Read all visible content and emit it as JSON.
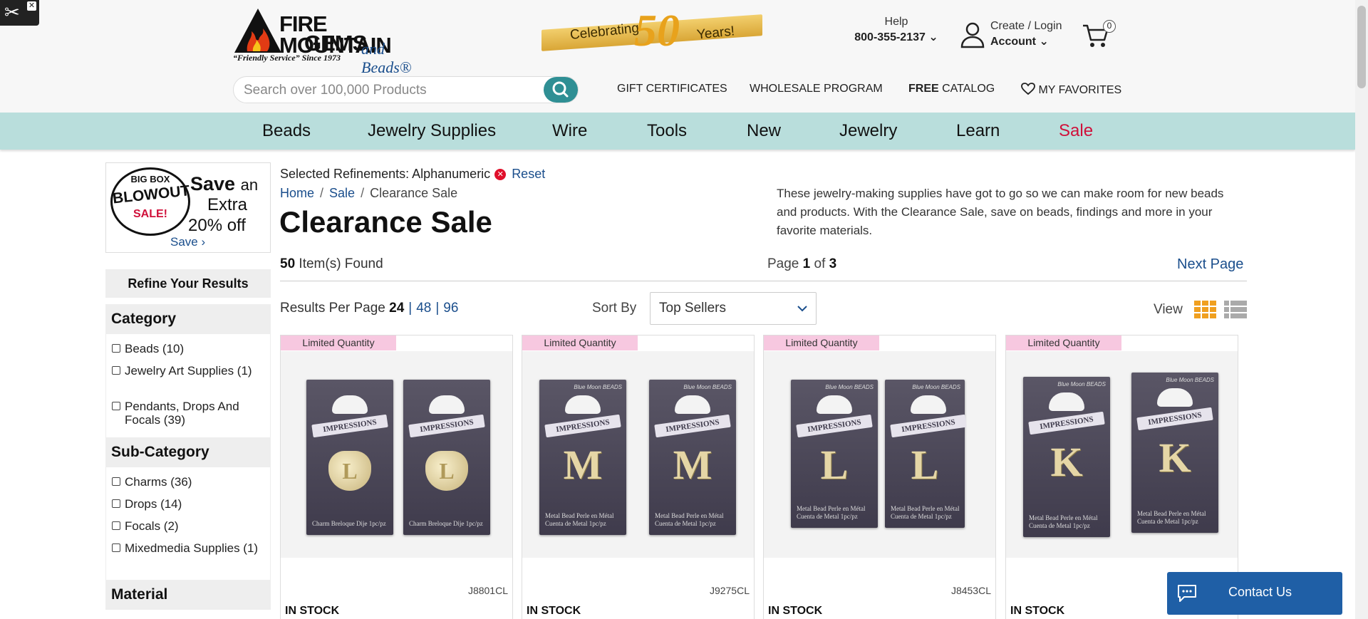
{
  "header": {
    "brand_line1": "FIRE MOUNTAIN",
    "brand_line2": "GEMS",
    "brand_line3": "and Beads®",
    "tagline": "“Friendly Service” Since 1973",
    "celebrating": "Celebrating",
    "fifty": "50",
    "years": "Years!",
    "help_label": "Help",
    "phone": "800-355-2137",
    "create_login": "Create / Login",
    "account": "Account",
    "cart_count": "0",
    "search_placeholder": "Search over 100,000 Products",
    "links": {
      "gift": "GIFT CERTIFICATES",
      "wholesale": "WHOLESALE PROGRAM",
      "free": "FREE",
      "catalog": "CATALOG",
      "favorites": "MY FAVORITES"
    }
  },
  "nav": [
    "Beads",
    "Jewelry Supplies",
    "Wire",
    "Tools",
    "New",
    "Jewelry",
    "Learn",
    "Sale"
  ],
  "sidebar": {
    "promo": {
      "big_box": "BIG BOX",
      "blowout": "BLOWOUT",
      "sale": "SALE!",
      "save": "Save",
      "an": "an",
      "extra": "Extra",
      "off": "20% off",
      "link": "Save ›"
    },
    "refine": "Refine Your Results",
    "category_title": "Category",
    "category": [
      "Beads (10)",
      "Jewelry Art Supplies (1)",
      "Pendants, Drops And Focals (39)"
    ],
    "subcategory_title": "Sub-Category",
    "subcategory": [
      "Charms (36)",
      "Drops (14)",
      "Focals (2)",
      "Mixedmedia Supplies (1)"
    ],
    "material_title": "Material"
  },
  "content": {
    "refinements_label": "Selected Refinements:",
    "refinement_value": "Alphanumeric",
    "reset": "Reset",
    "breadcrumbs": [
      "Home",
      "Sale",
      "Clearance Sale"
    ],
    "title": "Clearance Sale",
    "description": "These jewelry-making supplies have got to go so we can make room for new beads and products. With the Clearance Sale, save on beads, findings and more in your favorite materials.",
    "found_count": "50",
    "found_label": "Item(s) Found",
    "page_label": "Page",
    "page_current": "1",
    "page_of": "of",
    "page_total": "3",
    "next_page": "Next Page",
    "per_page_label": "Results Per Page",
    "per_page_current": "24",
    "per_page_opt1": "48",
    "per_page_opt2": "96",
    "per_page_sep": "|",
    "sort_label": "Sort By",
    "sort_value": "Top Sellers",
    "view_label": "View"
  },
  "products": [
    {
      "badge": "Limited Quantity",
      "letter": "L",
      "style": "heart",
      "foot": "Charm Breloque Dije   1pc/pz",
      "sku": "J8801CL",
      "stock": "IN STOCK"
    },
    {
      "badge": "Limited Quantity",
      "letter": "M",
      "style": "bead",
      "foot": "Metal Bead Perle en Métal Cuenta de Metal 1pc/pz",
      "sku": "J9275CL",
      "stock": "IN STOCK"
    },
    {
      "badge": "Limited Quantity",
      "letter": "L",
      "style": "bead",
      "foot": "Metal Bead Perle en Métal Cuenta de Metal 1pc/pz",
      "sku": "J8453CL",
      "stock": "IN STOCK"
    },
    {
      "badge": "Limited Quantity",
      "letter": "K",
      "style": "bead",
      "foot": "Metal Bead Perle en Métal Cuenta de Metal 1pc/pz",
      "sku": "",
      "stock": "IN STOCK"
    }
  ],
  "package": {
    "banner": "IMPRESSIONS",
    "brand": "Blue Moon BEADS"
  },
  "contact": "Contact Us",
  "colors": {
    "nav_bg": "#b9dedc",
    "sale_red": "#d0103a",
    "link_blue": "#1a4e8c",
    "teal_button": "#2f8f94",
    "badge_pink": "#f7c8e0",
    "grid_orange": "#f0a020",
    "contact_blue": "#1f5fa6"
  }
}
